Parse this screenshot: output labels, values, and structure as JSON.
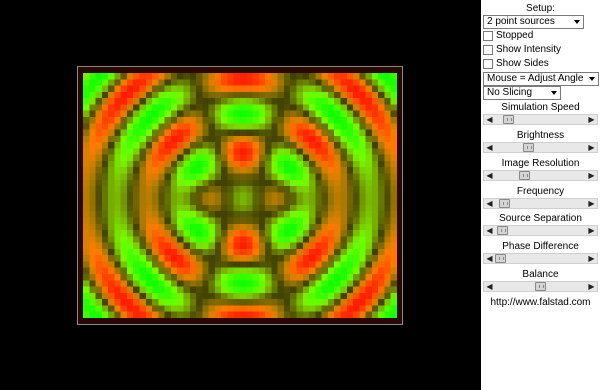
{
  "panel": {
    "setup_label": "Setup:",
    "setup_select": "2 point sources",
    "checkboxes": [
      {
        "label": "Stopped",
        "checked": false
      },
      {
        "label": "Show Intensity",
        "checked": false
      },
      {
        "label": "Show Sides",
        "checked": false
      }
    ],
    "mouse_select": "Mouse = Adjust Angle",
    "slicing_select": "No Slicing",
    "sliders": [
      {
        "label": "Simulation Speed",
        "value": 0.1
      },
      {
        "label": "Brightness",
        "value": 0.35
      },
      {
        "label": "Image Resolution",
        "value": 0.3
      },
      {
        "label": "Frequency",
        "value": 0.05
      },
      {
        "label": "Source Separation",
        "value": 0.02
      },
      {
        "label": "Phase Difference",
        "value": 0.0
      },
      {
        "label": "Balance",
        "value": 0.5
      }
    ],
    "url": "http://www.falstad.com"
  },
  "colors": {
    "positive": "#ff2a00",
    "negative": "#00ff10",
    "background": "#000000",
    "panel": "#ffffff"
  }
}
